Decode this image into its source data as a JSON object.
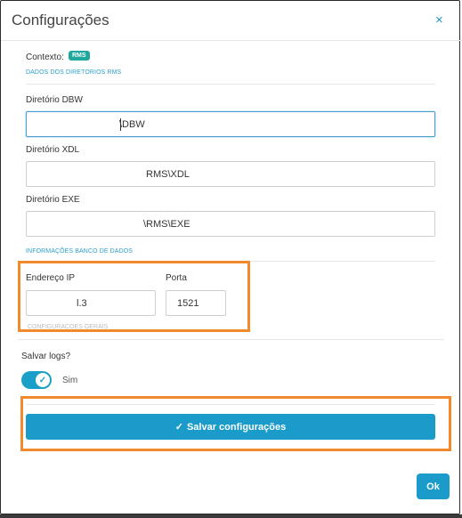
{
  "dialog": {
    "title": "Configurações",
    "close_icon": "×"
  },
  "context": {
    "label": "Contexto:",
    "badge": "RMS"
  },
  "sections": {
    "rms_dirs": "DADOS DOS DIRETORIOS RMS",
    "db_info": "INFORMAÇÕES BANCO DE DADOS",
    "partial": "CONFIGURAÇÕES GERAIS"
  },
  "fields": {
    "dbw": {
      "label": "Diretório DBW",
      "value": "\\DBW"
    },
    "xdl": {
      "label": "Diretório XDL",
      "value": "RMS\\XDL"
    },
    "exe": {
      "label": "Diretório EXE",
      "value": "\\RMS\\EXE"
    },
    "ip": {
      "label": "Endereço IP",
      "value": "l.3"
    },
    "port": {
      "label": "Porta",
      "value": "1521"
    }
  },
  "logs": {
    "label": "Salvar logs?",
    "toggle_text": "Sim",
    "toggle_on": true
  },
  "buttons": {
    "save": "Salvar configurações",
    "save_icon": "✓",
    "ok": "Ok"
  },
  "colors": {
    "accent": "#1a9bc9",
    "badge": "#1fa8a0",
    "highlight": "#f08a2d"
  }
}
